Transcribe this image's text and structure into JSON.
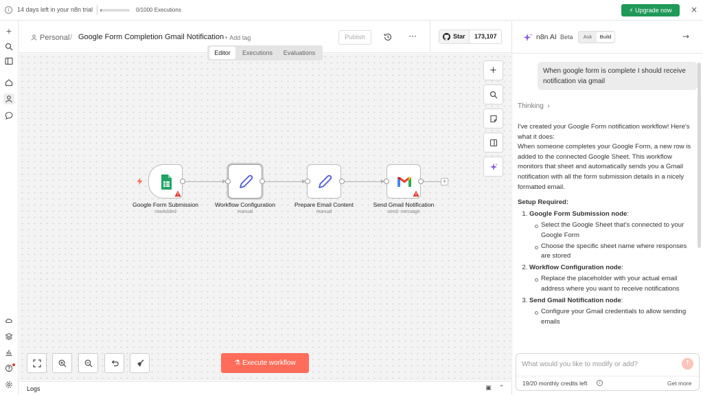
{
  "banner": {
    "trial_text": "14 days left in your n8n trial",
    "executions_text": "0/1000 Executions",
    "executions_progress": 0.0,
    "upgrade_label": "Upgrade now",
    "close_label": "×",
    "upgrade_color": "#1f9957"
  },
  "header": {
    "project": "Personal",
    "separator": "/",
    "workflow_title": "Google Form Completion Gmail Notification",
    "add_tag": "+ Add tag",
    "publish_label": "Publish",
    "more_label": "···",
    "github_star_label": "Star",
    "github_star_count": "173,107"
  },
  "tabs": [
    {
      "label": "Editor",
      "active": true
    },
    {
      "label": "Executions",
      "active": false
    },
    {
      "label": "Evaluations",
      "active": false
    }
  ],
  "nodes": [
    {
      "name": "Google Form Submission",
      "subtitle": "rowAdded",
      "icon": "google-sheets-icon",
      "warning": true
    },
    {
      "name": "Workflow Configuration",
      "subtitle": "manual",
      "icon": "pencil-icon",
      "warning": false
    },
    {
      "name": "Prepare Email Content",
      "subtitle": "manual",
      "icon": "pencil-icon",
      "warning": false
    },
    {
      "name": "Send Gmail Notification",
      "subtitle": "send: message",
      "icon": "gmail-icon",
      "warning": true
    }
  ],
  "canvas": {
    "execute_label": "Execute workflow",
    "execute_color": "#ff6d5a",
    "add_node_plus": "+"
  },
  "logs": {
    "title": "Logs"
  },
  "ai_panel": {
    "title": "n8n AI",
    "beta": "Beta",
    "mode_ask": "Ask",
    "mode_build": "Build",
    "active_mode": "Build",
    "user_message": "When google form is complete I should receive notification via gmail",
    "thinking_label": "Thinking",
    "intro_1": "I've created your Google Form notification workflow! Here's what it does:",
    "intro_2": "When someone completes your Google Form, a new row is added to the connected Google Sheet. This workflow monitors that sheet and automatically sends you a Gmail notification with all the form submission details in a nicely formatted email.",
    "setup_heading": "Setup Required:",
    "steps": [
      {
        "title": "Google Form Submission node",
        "suffix": ":",
        "bullets": [
          "Select the Google Sheet that's connected to your Google Form",
          "Choose the specific sheet name where responses are stored"
        ]
      },
      {
        "title": "Workflow Configuration node",
        "suffix": ":",
        "bullets": [
          "Replace the placeholder with your actual email address where you want to receive notifications"
        ]
      },
      {
        "title": "Send Gmail Notification node",
        "suffix": ":",
        "bullets": [
          "Configure your Gmail credentials to allow sending emails"
        ]
      }
    ],
    "input_placeholder": "What would you like to modify or add?",
    "credits_text": "19/20 monthly credits left",
    "get_more_label": "Get more"
  }
}
